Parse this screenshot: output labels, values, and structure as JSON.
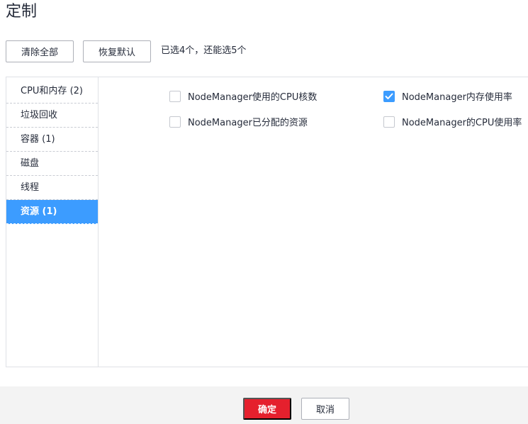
{
  "dialog": {
    "title": "定制"
  },
  "toolbar": {
    "clear_all_label": "清除全部",
    "restore_default_label": "恢复默认",
    "selected_info": "已选4个，还能选5个"
  },
  "sidebar": {
    "items": [
      {
        "label": "CPU和内存 (2)",
        "active": false
      },
      {
        "label": "垃圾回收",
        "active": false
      },
      {
        "label": "容器 (1)",
        "active": false
      },
      {
        "label": "磁盘",
        "active": false
      },
      {
        "label": "线程",
        "active": false
      },
      {
        "label": "资源 (1)",
        "active": true
      }
    ]
  },
  "options": [
    {
      "label": "NodeManager使用的CPU核数",
      "checked": false
    },
    {
      "label": "NodeManager内存使用率",
      "checked": true
    },
    {
      "label": "NodeManager已分配的资源",
      "checked": false
    },
    {
      "label": "NodeManager的CPU使用率",
      "checked": false
    }
  ],
  "footer": {
    "ok_label": "确定",
    "cancel_label": "取消"
  },
  "colors": {
    "accent": "#3c9cff",
    "primary_button": "#e5202d"
  },
  "icons": {
    "checkbox_checked": "check-icon"
  }
}
